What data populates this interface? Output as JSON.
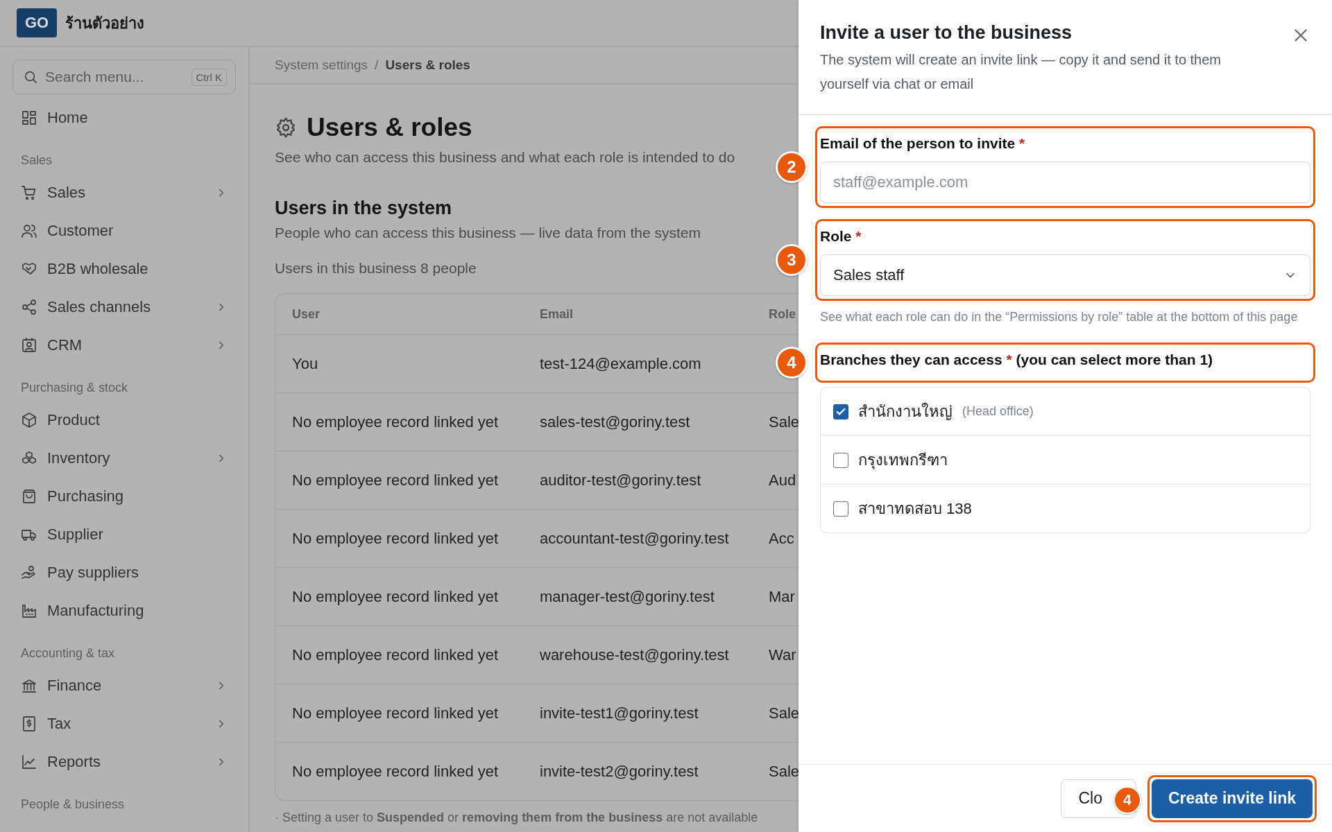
{
  "topbar": {
    "logo": "GO",
    "store_name": "ร้านตัวอย่าง"
  },
  "sidebar": {
    "search": {
      "placeholder": "Search menu...",
      "shortcut": "Ctrl K"
    },
    "sections": [
      {
        "items": [
          {
            "label": "Home",
            "has_submenu": false
          }
        ]
      },
      {
        "title": "Sales",
        "items": [
          {
            "label": "Sales",
            "has_submenu": true
          },
          {
            "label": "Customer",
            "has_submenu": false
          },
          {
            "label": "B2B wholesale",
            "has_submenu": false
          },
          {
            "label": "Sales channels",
            "has_submenu": true
          },
          {
            "label": "CRM",
            "has_submenu": true
          }
        ]
      },
      {
        "title": "Purchasing & stock",
        "items": [
          {
            "label": "Product",
            "has_submenu": false
          },
          {
            "label": "Inventory",
            "has_submenu": true
          },
          {
            "label": "Purchasing",
            "has_submenu": false
          },
          {
            "label": "Supplier",
            "has_submenu": false
          },
          {
            "label": "Pay suppliers",
            "has_submenu": false
          },
          {
            "label": "Manufacturing",
            "has_submenu": false
          }
        ]
      },
      {
        "title": "Accounting & tax",
        "items": [
          {
            "label": "Finance",
            "has_submenu": true
          },
          {
            "label": "Tax",
            "has_submenu": true
          },
          {
            "label": "Reports",
            "has_submenu": true
          }
        ]
      },
      {
        "title": "People & business"
      }
    ]
  },
  "breadcrumb": {
    "separator": "/",
    "items": [
      {
        "label": "System settings",
        "current": false
      },
      {
        "label": "Users & roles",
        "current": true
      }
    ]
  },
  "page": {
    "title": "Users & roles",
    "subtitle": "See who can access this business and what each role is intended to do",
    "section_title": "Users in the system",
    "section_description": "People who can access this business — live data from the system",
    "count": "Users in this business 8 people"
  },
  "table": {
    "columns": [
      "User",
      "Email",
      "Role"
    ],
    "rows": [
      [
        "You",
        "test-124@example.com"
      ],
      [
        "No employee record linked yet",
        "sales-test@goriny.test",
        "Sale"
      ],
      [
        "No employee record linked yet",
        "auditor-test@goriny.test",
        "Aud"
      ],
      [
        "No employee record linked yet",
        "accountant-test@goriny.test",
        "Acc"
      ],
      [
        "No employee record linked yet",
        "manager-test@goriny.test",
        "Mar"
      ],
      [
        "No employee record linked yet",
        "warehouse-test@goriny.test",
        "War"
      ],
      [
        "No employee record linked yet",
        "invite-test1@goriny.test",
        "Sale"
      ],
      [
        "No employee record linked yet",
        "invite-test2@goriny.test",
        "Sale"
      ]
    ]
  },
  "footnote": "· Setting a user to **Suspended** or **removing them from the business** are not available",
  "drawer": {
    "title": "Invite a user to the business",
    "description": "The system will create an invite link — copy it and send it to them yourself via chat or email",
    "email": {
      "label": "Email of the person to invite",
      "required_mark": "*",
      "placeholder": "staff@example.com",
      "highlighted": true,
      "badge": "2"
    },
    "role": {
      "label": "Role",
      "required_mark": "*",
      "value": "Sales staff",
      "highlighted": true,
      "badge": "3",
      "hint": "See what each role can do in the “Permissions by role” table at the bottom of this page"
    },
    "branches": {
      "label": "Branches they can access",
      "required_mark": "*",
      "suffix": "(you can select more than 1)",
      "highlighted": true,
      "badge": "4",
      "options": [
        {
          "label": "สำนักงานใหญ่",
          "note": "(Head office)",
          "checked": true
        },
        {
          "label": "กรุงเทพกรีฑา",
          "checked": false
        },
        {
          "label": "สาขาทดสอบ 138",
          "checked": false
        }
      ]
    },
    "buttons": [
      {
        "label": "Clo",
        "kind": "secondary",
        "highlighted": false,
        "badge": "4"
      },
      {
        "label": "Create invite link",
        "kind": "primary",
        "highlighted": true
      }
    ]
  }
}
